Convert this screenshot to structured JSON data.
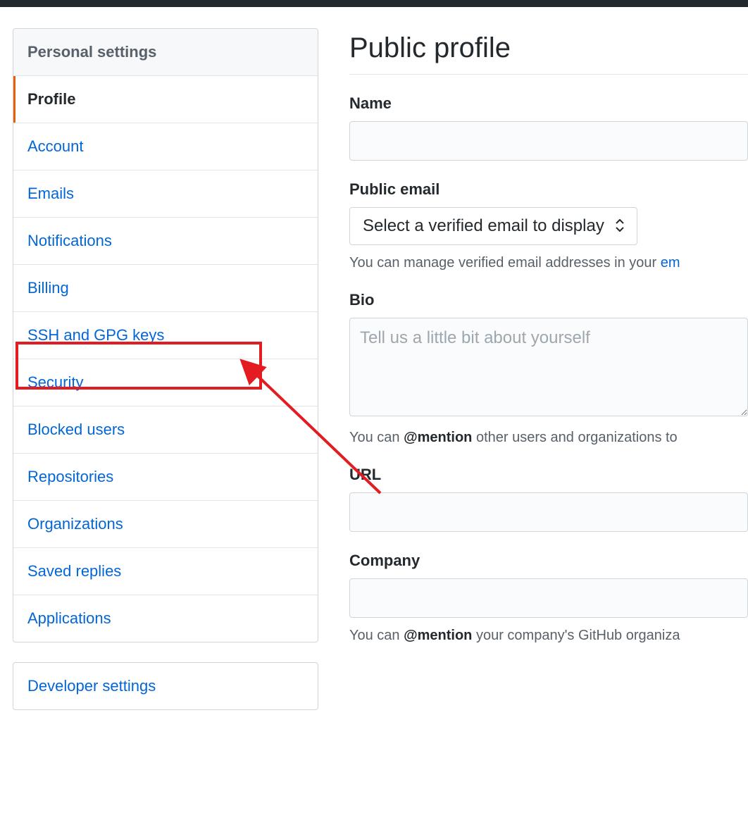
{
  "sidebar": {
    "heading": "Personal settings",
    "items": [
      {
        "label": "Profile",
        "selected": true
      },
      {
        "label": "Account"
      },
      {
        "label": "Emails"
      },
      {
        "label": "Notifications"
      },
      {
        "label": "Billing"
      },
      {
        "label": "SSH and GPG keys",
        "highlighted": true
      },
      {
        "label": "Security"
      },
      {
        "label": "Blocked users"
      },
      {
        "label": "Repositories"
      },
      {
        "label": "Organizations"
      },
      {
        "label": "Saved replies"
      },
      {
        "label": "Applications"
      }
    ],
    "secondary": [
      {
        "label": "Developer settings"
      }
    ]
  },
  "main": {
    "title": "Public profile",
    "name": {
      "label": "Name",
      "value": ""
    },
    "public_email": {
      "label": "Public email",
      "selected": "Select a verified email to display",
      "note_pre": "You can manage verified email addresses in your ",
      "note_link": "em"
    },
    "bio": {
      "label": "Bio",
      "placeholder": "Tell us a little bit about yourself",
      "value": "",
      "note_pre": "You can ",
      "note_strong": "@mention",
      "note_post": " other users and organizations to"
    },
    "url": {
      "label": "URL",
      "value": ""
    },
    "company": {
      "label": "Company",
      "value": "",
      "note_pre": "You can ",
      "note_strong": "@mention",
      "note_post": " your company's GitHub organiza"
    }
  }
}
